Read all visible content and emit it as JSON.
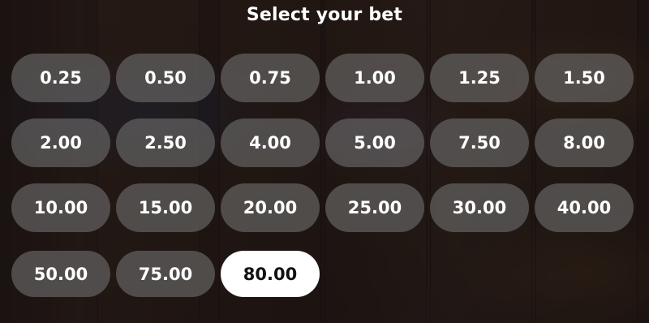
{
  "title": "Select your bet",
  "colors": {
    "button_bg": "#6e6e6e",
    "button_text": "#ffffff",
    "selected_bg": "#ffffff",
    "selected_text": "#111111"
  },
  "bets": [
    {
      "label": "0.25",
      "selected": false
    },
    {
      "label": "0.50",
      "selected": false
    },
    {
      "label": "0.75",
      "selected": false
    },
    {
      "label": "1.00",
      "selected": false
    },
    {
      "label": "1.25",
      "selected": false
    },
    {
      "label": "1.50",
      "selected": false
    },
    {
      "label": "2.00",
      "selected": false
    },
    {
      "label": "2.50",
      "selected": false
    },
    {
      "label": "4.00",
      "selected": false
    },
    {
      "label": "5.00",
      "selected": false
    },
    {
      "label": "7.50",
      "selected": false
    },
    {
      "label": "8.00",
      "selected": false
    },
    {
      "label": "10.00",
      "selected": false
    },
    {
      "label": "15.00",
      "selected": false
    },
    {
      "label": "20.00",
      "selected": false
    },
    {
      "label": "25.00",
      "selected": false
    },
    {
      "label": "30.00",
      "selected": false
    },
    {
      "label": "40.00",
      "selected": false
    },
    {
      "label": "50.00",
      "selected": false
    },
    {
      "label": "75.00",
      "selected": false
    },
    {
      "label": "80.00",
      "selected": true
    }
  ]
}
